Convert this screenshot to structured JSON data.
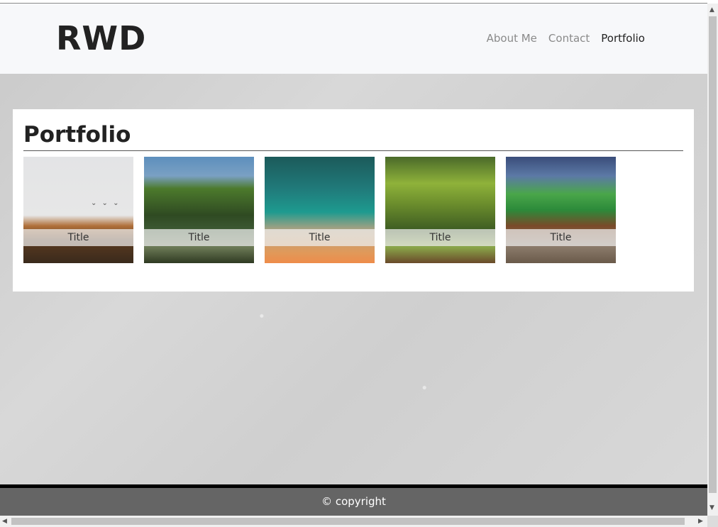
{
  "header": {
    "logo": "RWD",
    "nav": [
      {
        "label": "About Me"
      },
      {
        "label": "Contact"
      },
      {
        "label": "Portfolio"
      }
    ]
  },
  "main": {
    "heading": "Portfolio",
    "items": [
      {
        "caption": "Title"
      },
      {
        "caption": "Title"
      },
      {
        "caption": "Title"
      },
      {
        "caption": "Title"
      },
      {
        "caption": "Title"
      }
    ]
  },
  "footer": {
    "text": "© copyright"
  }
}
